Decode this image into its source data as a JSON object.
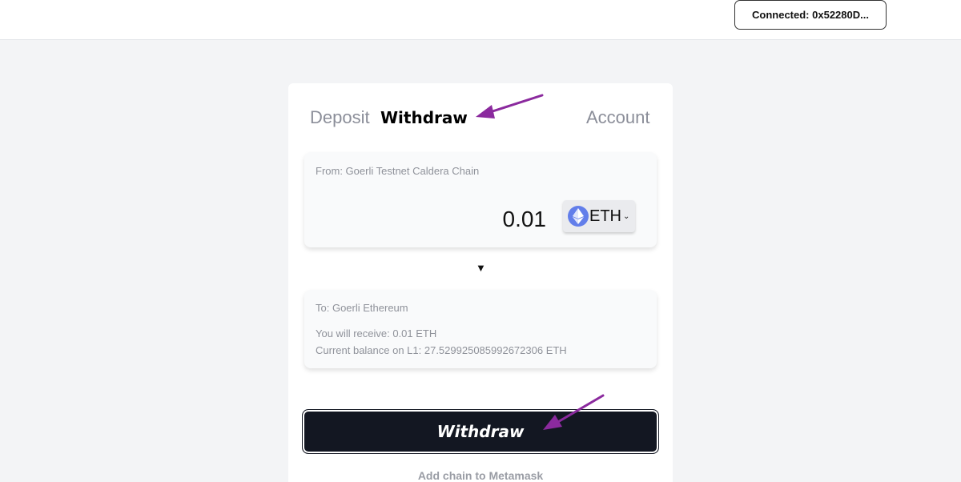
{
  "header": {
    "connect_label": "Connected: 0x52280D..."
  },
  "tabs": {
    "deposit": "Deposit",
    "withdraw": "Withdraw",
    "account": "Account"
  },
  "from_panel": {
    "label": "From: Goerli Testnet Caldera Chain",
    "amount": "0.01",
    "token": "ETH",
    "token_icon": "ethereum-icon"
  },
  "swap_arrow": "▼",
  "to_panel": {
    "label": "To: Goerli Ethereum",
    "receive": "You will receive: 0.01 ETH",
    "balance": "Current balance on L1: 27.529925085992672306 ETH"
  },
  "actions": {
    "withdraw_label": "Withdraw",
    "add_chain_label": "Add chain to Metamask"
  },
  "colors": {
    "accent_button": "#131722",
    "annotation_arrow": "#8b2a9e",
    "eth_icon": "#627eea"
  }
}
